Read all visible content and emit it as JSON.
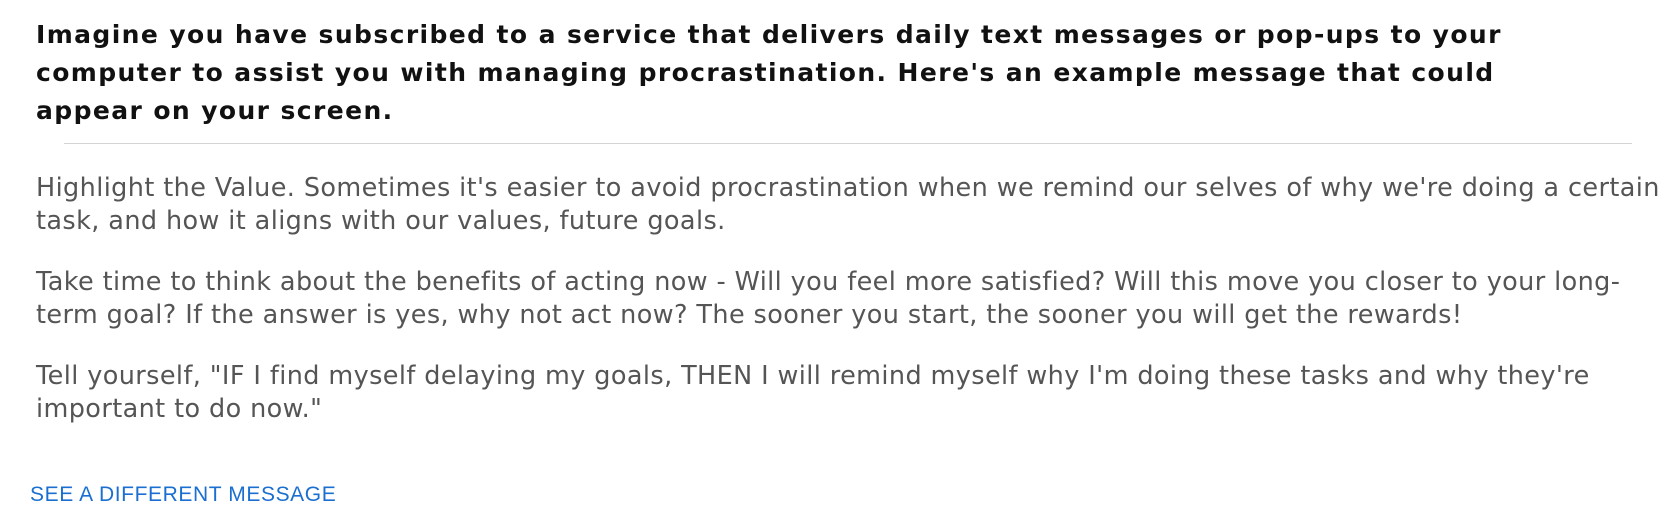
{
  "heading": "Imagine you have subscribed to a service that delivers daily text messages or pop-ups to your computer to assist you with managing procrastination. Here's an example message that could appear on your screen.",
  "message": {
    "paragraphs": [
      "Highlight the Value. Sometimes it's easier to avoid procrastination when we remind our selves of why we're doing a certain task, and how it aligns with our values, future goals.",
      "Take time to think about the benefits of acting now - Will you feel more satisfied? Will this move you closer to your long-term goal? If the answer is yes, why not act now? The sooner you start, the sooner you will get the rewards!",
      "Tell yourself, \"IF I find myself delaying my goals, THEN I will remind myself why I'm doing these tasks and why they're important to do now.\""
    ]
  },
  "actions": {
    "different_message_label": "SEE A DIFFERENT MESSAGE"
  },
  "colors": {
    "heading_text": "#111111",
    "body_text": "#555555",
    "link": "#1a6fd1",
    "divider": "#d4d4d4"
  }
}
